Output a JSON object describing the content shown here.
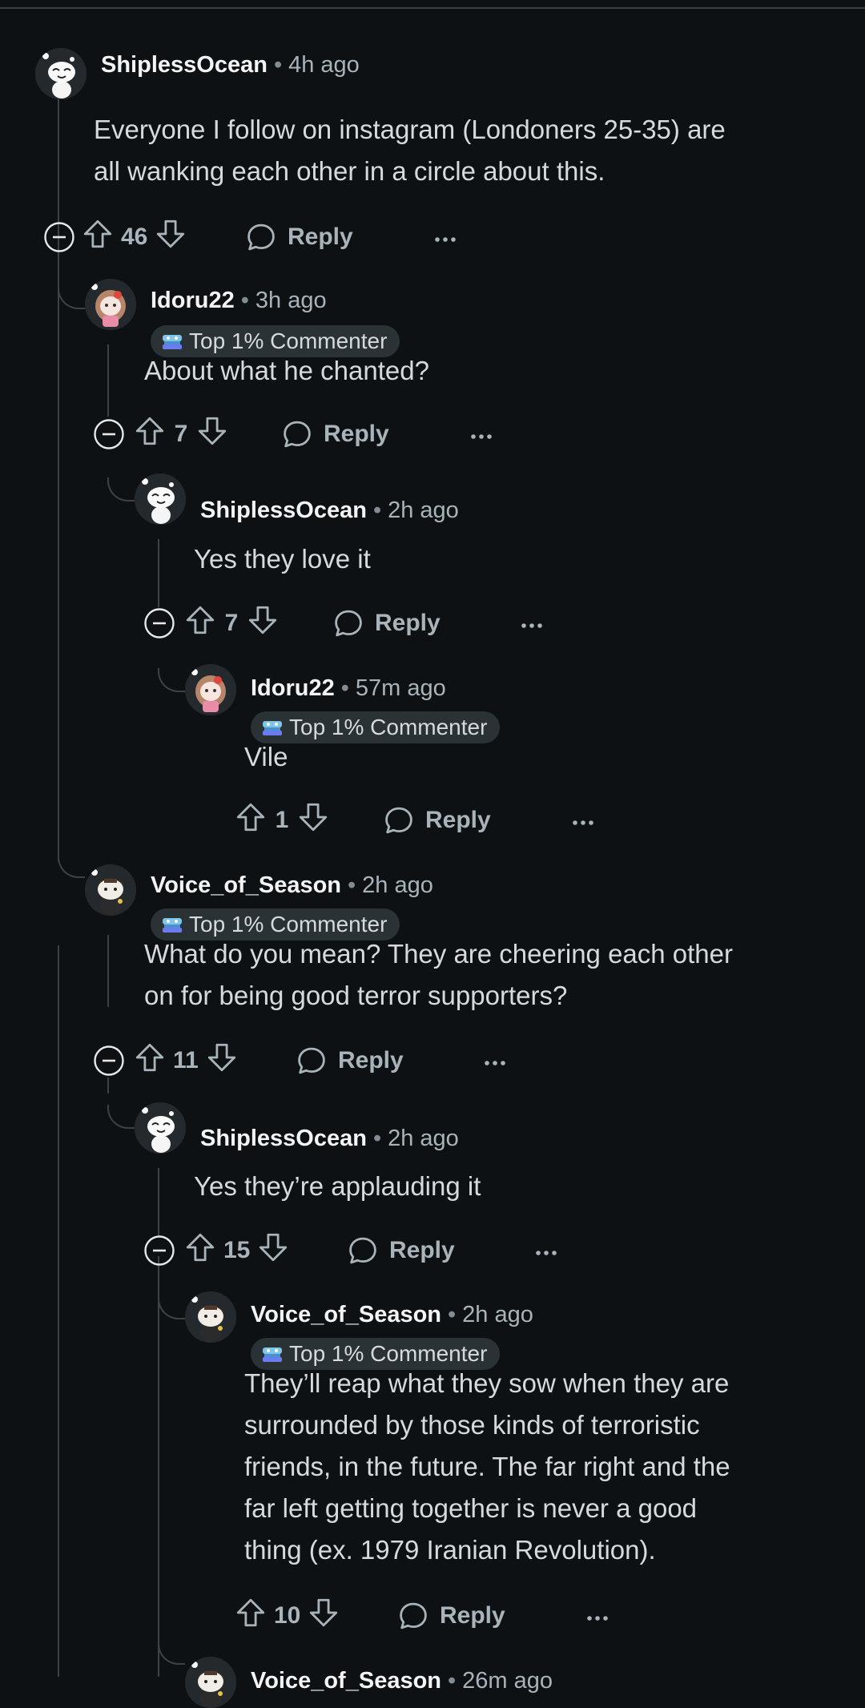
{
  "comments": [
    {
      "author": "ShiplessOcean",
      "time": "4h ago",
      "flair": "",
      "body": [
        "Everyone I follow on instagram (Londoners 25-35) are",
        "all wanking each other in a circle about this."
      ],
      "score": "46",
      "reply_label": "Reply"
    },
    {
      "author": "Idoru22",
      "time": "3h ago",
      "flair": "Top 1% Commenter",
      "body": [
        "About what he chanted?"
      ],
      "score": "7",
      "reply_label": "Reply"
    },
    {
      "author": "ShiplessOcean",
      "time": "2h ago",
      "flair": "",
      "body": [
        "Yes they love it"
      ],
      "score": "7",
      "reply_label": "Reply"
    },
    {
      "author": "Idoru22",
      "time": "57m ago",
      "flair": "Top 1% Commenter",
      "body": [
        "Vile"
      ],
      "score": "1",
      "reply_label": "Reply"
    },
    {
      "author": "Voice_of_Season",
      "time": "2h ago",
      "flair": "Top 1% Commenter",
      "body": [
        "What do you mean? They are cheering each other",
        "on for being good terror supporters?"
      ],
      "score": "11",
      "reply_label": "Reply"
    },
    {
      "author": "ShiplessOcean",
      "time": "2h ago",
      "flair": "",
      "body": [
        "Yes they’re applauding it"
      ],
      "score": "15",
      "reply_label": "Reply"
    },
    {
      "author": "Voice_of_Season",
      "time": "2h ago",
      "flair": "Top 1% Commenter",
      "body": [
        "They’ll reap what they sow when they are",
        "surrounded by those kinds of terroristic",
        "friends, in the future. The far right and the",
        "far left getting together is never a good",
        "thing (ex. 1979 Iranian Revolution)."
      ],
      "score": "10",
      "reply_label": "Reply"
    },
    {
      "author": "Voice_of_Season",
      "time": "26m ago",
      "flair": "",
      "body": [],
      "score": "",
      "reply_label": ""
    }
  ],
  "icons": {
    "upvote": "upvote-arrow-icon",
    "downvote": "downvote-arrow-icon",
    "reply": "speech-bubble-icon",
    "more": "ellipsis-icon",
    "collapse": "collapse-minus-icon",
    "flair": "commenter-badge-icon"
  },
  "colors": {
    "background": "#0e1113",
    "text": "#d7dadc",
    "muted": "#a8b3ba",
    "author": "#f2f4f5",
    "flair_bg": "#2a3236",
    "thread": "#3d4245"
  }
}
